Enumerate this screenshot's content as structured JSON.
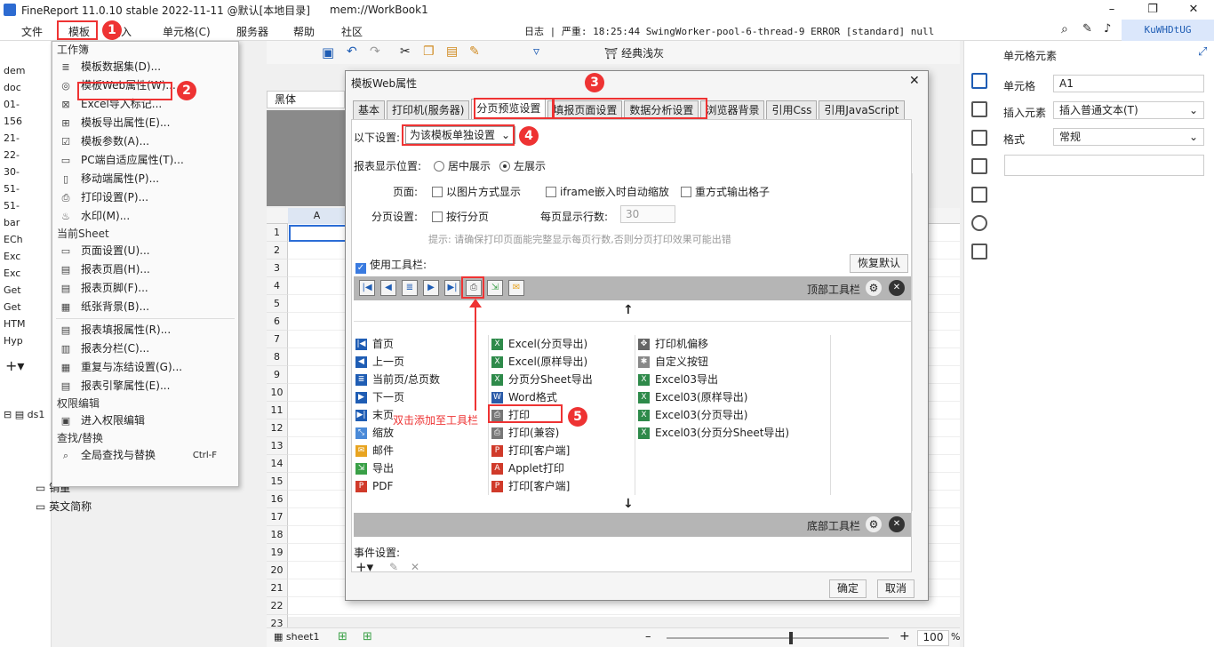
{
  "window": {
    "title": "FineReport 11.0.10 stable 2022-11-11 @默认[本地目录]",
    "file": "mem://WorkBook1",
    "minimize": "–",
    "maximize": "❐",
    "close": "✕"
  },
  "menubar": {
    "items": [
      "文件",
      "模板",
      "插入",
      "单元格(C)",
      "服务器",
      "帮助",
      "社区"
    ],
    "log_label": "日志",
    "status": "严重: 18:25:44 SwingWorker-pool-6-thread-9 ERROR [standard] null",
    "user": "KuWHDtUG"
  },
  "tree": {
    "items": [
      "dem",
      "doc",
      "01-",
      "156",
      "21-",
      "22-",
      "30-",
      "51-",
      "51-",
      "bar",
      "ECh",
      "Exc",
      "Exc",
      "Get",
      "Get",
      "HTM",
      "Hyp"
    ],
    "ds": "ds1",
    "fields": [
      "销量",
      "英文简称"
    ]
  },
  "dropdown": {
    "sec1": "工作簿",
    "items1": [
      {
        "icon": "≣",
        "label": "模板数据集(D)..."
      },
      {
        "icon": "◎",
        "label": "模板Web属性(W)..."
      },
      {
        "icon": "⊠",
        "label": "Excel导入标记..."
      },
      {
        "icon": "⊞",
        "label": "模板导出属性(E)..."
      },
      {
        "icon": "☑",
        "label": "模板参数(A)..."
      },
      {
        "icon": "▭",
        "label": "PC端自适应属性(T)..."
      },
      {
        "icon": "▯",
        "label": "移动端属性(P)..."
      },
      {
        "icon": "⎙",
        "label": "打印设置(P)..."
      },
      {
        "icon": "♨",
        "label": "水印(M)..."
      }
    ],
    "sec2": "当前Sheet",
    "items2": [
      {
        "icon": "▭",
        "label": "页面设置(U)..."
      },
      {
        "icon": "▤",
        "label": "报表页眉(H)..."
      },
      {
        "icon": "▤",
        "label": "报表页脚(F)..."
      },
      {
        "icon": "▦",
        "label": "纸张背景(B)..."
      }
    ],
    "items3": [
      {
        "icon": "▤",
        "label": "报表填报属性(R)..."
      },
      {
        "icon": "▥",
        "label": "报表分栏(C)..."
      },
      {
        "icon": "▦",
        "label": "重复与冻结设置(G)..."
      },
      {
        "icon": "▤",
        "label": "报表引擎属性(E)..."
      }
    ],
    "sec3": "权限编辑",
    "items4": [
      {
        "icon": "▣",
        "label": "进入权限编辑"
      }
    ],
    "sec4": "查找/替换",
    "items5": [
      {
        "icon": "⌕",
        "label": "全局查找与替换",
        "shortcut": "Ctrl-F"
      }
    ]
  },
  "toolbar": {
    "font": "黑体",
    "style_label": "经典浅灰"
  },
  "sheet": {
    "col_a": "A",
    "rows": [
      "1",
      "2",
      "3",
      "4",
      "5",
      "6",
      "7",
      "8",
      "9",
      "10",
      "11",
      "12",
      "13",
      "14",
      "15",
      "16",
      "17",
      "18",
      "19",
      "20",
      "21",
      "22",
      "23"
    ],
    "tab": "sheet1",
    "zoom": "100",
    "zoom_unit": "%"
  },
  "props": {
    "title": "单元格元素",
    "cell_label": "单元格",
    "cell_value": "A1",
    "insert_label": "插入元素",
    "insert_value": "插入普通文本(T)",
    "format_label": "格式",
    "format_value": "常规"
  },
  "dialog": {
    "title": "模板Web属性",
    "tabs": [
      "基本",
      "打印机(服务器)",
      "分页预览设置",
      "填报页面设置",
      "数据分析设置",
      "浏览器背景",
      "引用Css",
      "引用JavaScript"
    ],
    "scope_label": "以下设置:",
    "scope_value": "为该模板单独设置",
    "pos_label": "报表显示位置:",
    "pos_center": "居中展示",
    "pos_left": "左展示",
    "page_label": "页面:",
    "opt_img": "以图片方式显示",
    "opt_iframe": "iframe嵌入时自动缩放",
    "opt_overlap": "重方式输出格子",
    "paging_label": "分页设置:",
    "opt_rowpage": "按行分页",
    "rows_per_page_label": "每页显示行数:",
    "rows_per_page": "30",
    "hint": "提示: 请确保打印页面能完整显示每页行数,否则分页打印效果可能出错",
    "use_toolbar": "使用工具栏:",
    "restore": "恢复默认",
    "top_toolbar": "顶部工具栏",
    "bottom_toolbar": "底部工具栏",
    "col1": [
      {
        "icon": "|◀",
        "color": "#1f5db4",
        "label": "首页"
      },
      {
        "icon": "◀",
        "color": "#1f5db4",
        "label": "上一页"
      },
      {
        "icon": "≣",
        "color": "#1f5db4",
        "label": "当前页/总页数"
      },
      {
        "icon": "▶",
        "color": "#1f5db4",
        "label": "下一页"
      },
      {
        "icon": "▶|",
        "color": "#1f5db4",
        "label": "末页"
      },
      {
        "icon": "⤡",
        "color": "#4a8ad8",
        "label": "缩放"
      },
      {
        "icon": "✉",
        "color": "#e8a420",
        "label": "邮件"
      },
      {
        "icon": "⇲",
        "color": "#3aa047",
        "label": "导出"
      },
      {
        "icon": "P",
        "color": "#d03a2a",
        "label": "PDF"
      }
    ],
    "col2": [
      {
        "icon": "X",
        "color": "#2e8a4a",
        "label": "Excel(分页导出)"
      },
      {
        "icon": "X",
        "color": "#2e8a4a",
        "label": "Excel(原样导出)"
      },
      {
        "icon": "X",
        "color": "#2e8a4a",
        "label": "分页分Sheet导出"
      },
      {
        "icon": "W",
        "color": "#2b5ba8",
        "label": "Word格式"
      },
      {
        "icon": "⎙",
        "color": "#777",
        "label": "打印"
      },
      {
        "icon": "⎙",
        "color": "#777",
        "label": "打印(兼容)"
      },
      {
        "icon": "P",
        "color": "#d03a2a",
        "label": "打印[客户端]"
      },
      {
        "icon": "A",
        "color": "#d03a2a",
        "label": "Applet打印"
      },
      {
        "icon": "P",
        "color": "#d03a2a",
        "label": "打印[客户端]"
      }
    ],
    "col3": [
      {
        "icon": "✥",
        "color": "#666",
        "label": "打印机偏移"
      },
      {
        "icon": "✱",
        "color": "#888",
        "label": "自定义按钮"
      },
      {
        "icon": "X",
        "color": "#2e8a4a",
        "label": "Excel03导出"
      },
      {
        "icon": "X",
        "color": "#2e8a4a",
        "label": "Excel03(原样导出)"
      },
      {
        "icon": "X",
        "color": "#2e8a4a",
        "label": "Excel03(分页导出)"
      },
      {
        "icon": "X",
        "color": "#2e8a4a",
        "label": "Excel03(分页分Sheet导出)"
      }
    ],
    "events_label": "事件设置:",
    "ok": "确定",
    "cancel": "取消",
    "annotation": "双击添加至工具栏"
  },
  "badges": [
    "1",
    "2",
    "3",
    "4",
    "5"
  ],
  "accent": "#e33333"
}
